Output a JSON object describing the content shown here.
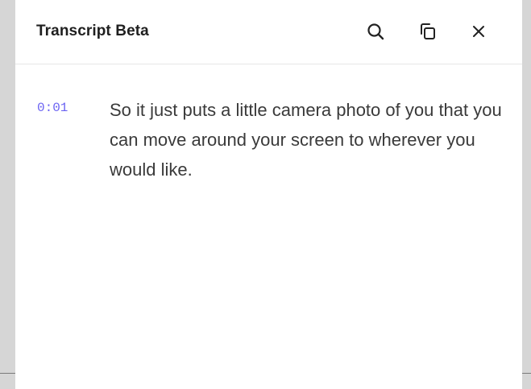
{
  "panel": {
    "title": "Transcript Beta",
    "icons": {
      "search": "search-icon",
      "copy": "copy-icon",
      "close": "close-icon"
    }
  },
  "transcript": [
    {
      "timestamp": "0:01",
      "text": "So it just puts a little camera photo of you that you can move around your screen to wherever you would like."
    }
  ],
  "colors": {
    "timestamp": "#6b63f2",
    "text": "#3a3a3a",
    "background": "#d6d6d6",
    "panel": "#ffffff"
  }
}
